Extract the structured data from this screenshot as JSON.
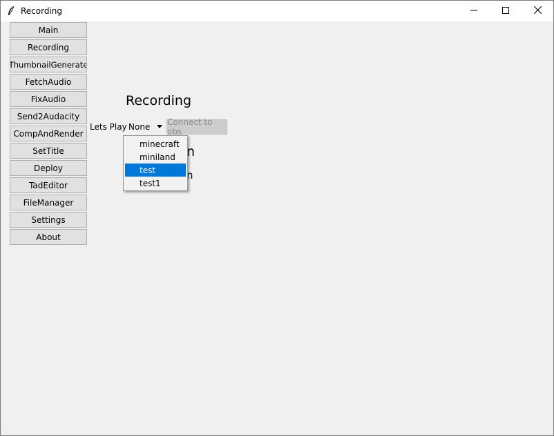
{
  "window": {
    "title": "Recording",
    "icon": "feather-icon",
    "controls": [
      "minimize-icon",
      "maximize-icon",
      "close-icon"
    ]
  },
  "sidebar": {
    "items": [
      {
        "label": "Main"
      },
      {
        "label": "Recording"
      },
      {
        "label": "ThumbnailGenerate"
      },
      {
        "label": "FetchAudio"
      },
      {
        "label": "FixAudio"
      },
      {
        "label": "Send2Audacity"
      },
      {
        "label": "CompAndRender"
      },
      {
        "label": "SetTitle"
      },
      {
        "label": "Deploy"
      },
      {
        "label": "TadEditor"
      },
      {
        "label": "FileManager"
      },
      {
        "label": "Settings"
      },
      {
        "label": "About"
      }
    ]
  },
  "main": {
    "title": "Recording",
    "lets_play_label": "Lets Play",
    "lets_play_value": "None",
    "connect_button": "Connect to obs",
    "obscured_text_1": "n",
    "obscured_text_2": "n"
  },
  "dropdown": {
    "options": [
      {
        "label": "minecraft",
        "selected": false
      },
      {
        "label": "miniland",
        "selected": false
      },
      {
        "label": "test",
        "selected": true
      },
      {
        "label": "test1",
        "selected": false
      }
    ],
    "highlight_color": "#0078d7"
  }
}
